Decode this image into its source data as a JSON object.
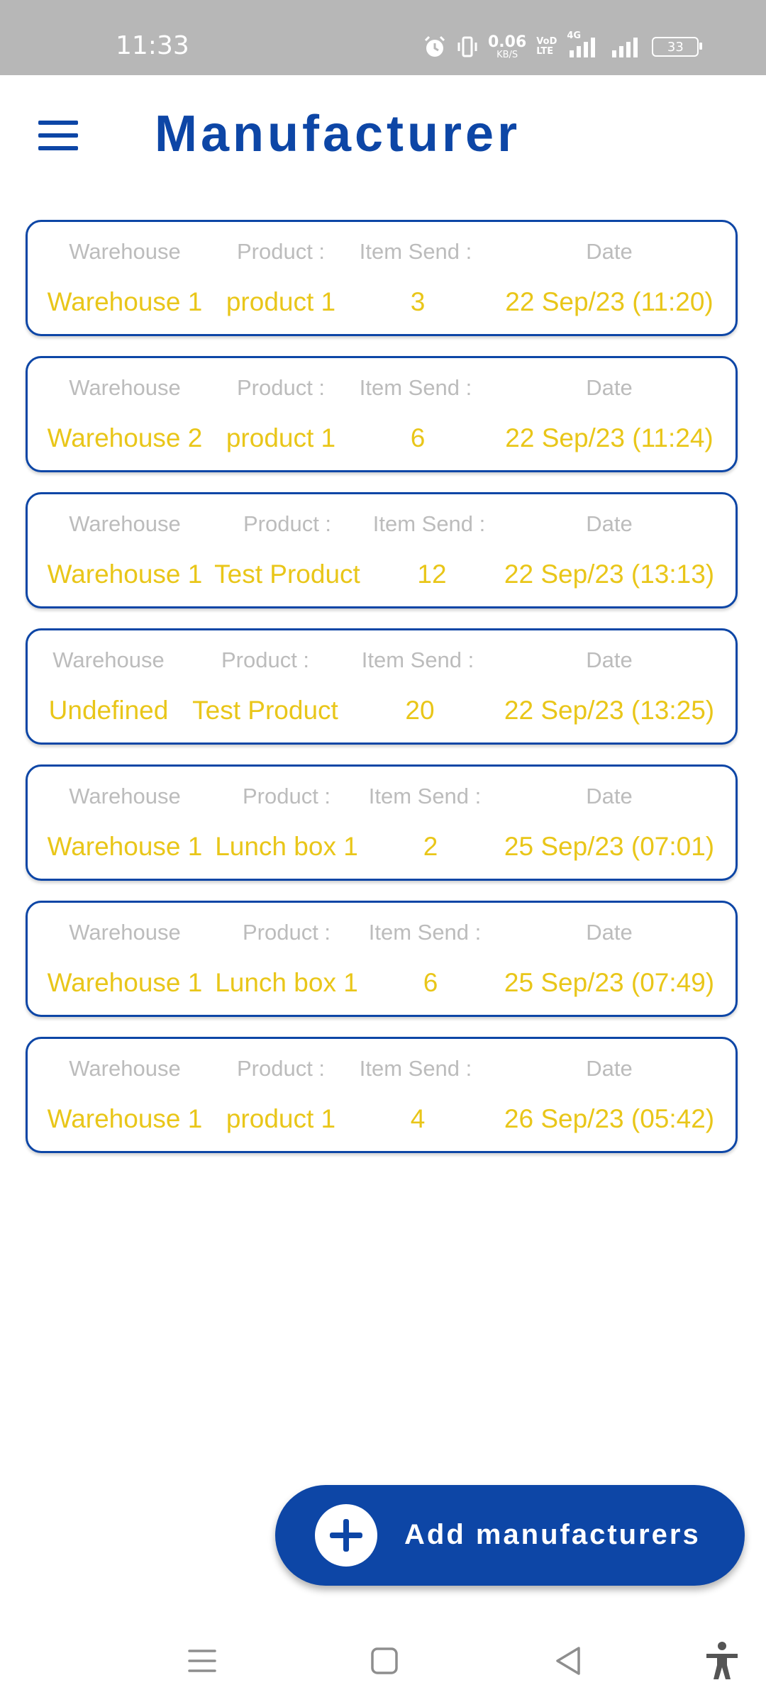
{
  "status_bar": {
    "time": "11:33",
    "speed_value": "0.06",
    "speed_unit": "KB/S",
    "volte_top": "VoD",
    "volte_bottom": "LTE",
    "network": "4G",
    "battery": "33",
    "icons": [
      "alarm-icon",
      "vibrate-icon",
      "signal-icon",
      "signal-icon-2",
      "battery-icon"
    ]
  },
  "header": {
    "title": "Manufacturer",
    "menu_icon": "hamburger-menu-icon"
  },
  "records": [
    {
      "warehouse_label": "Warehouse",
      "product_label": "Product :",
      "items_label": "Item Send :",
      "date_label": "Date",
      "warehouse": "Warehouse 1",
      "product": "product 1",
      "items": "3",
      "date": "22 Sep/23 (11:20)"
    },
    {
      "warehouse_label": "Warehouse",
      "product_label": "Product :",
      "items_label": "Item Send :",
      "date_label": "Date",
      "warehouse": "Warehouse 2",
      "product": "product 1",
      "items": "6",
      "date": "22 Sep/23 (11:24)"
    },
    {
      "warehouse_label": "Warehouse",
      "product_label": "Product :",
      "items_label": "Item Send :",
      "date_label": "Date",
      "warehouse": "Warehouse 1",
      "product": "Test Product",
      "items": "12",
      "date": "22 Sep/23 (13:13)"
    },
    {
      "warehouse_label": "Warehouse",
      "product_label": "Product :",
      "items_label": "Item Send :",
      "date_label": "Date",
      "warehouse": "Undefined",
      "product": "Test Product",
      "items": "20",
      "date": "22 Sep/23 (13:25)"
    },
    {
      "warehouse_label": "Warehouse",
      "product_label": "Product :",
      "items_label": "Item Send :",
      "date_label": "Date",
      "warehouse": "Warehouse 1",
      "product": "Lunch box 1",
      "items": "2",
      "date": "25 Sep/23 (07:01)"
    },
    {
      "warehouse_label": "Warehouse",
      "product_label": "Product :",
      "items_label": "Item Send :",
      "date_label": "Date",
      "warehouse": "Warehouse 1",
      "product": "Lunch box 1",
      "items": "6",
      "date": "25 Sep/23 (07:49)"
    },
    {
      "warehouse_label": "Warehouse",
      "product_label": "Product :",
      "items_label": "Item Send :",
      "date_label": "Date",
      "warehouse": "Warehouse 1",
      "product": "product 1",
      "items": "4",
      "date": "26 Sep/23 (05:42)"
    }
  ],
  "fab": {
    "label": "Add manufacturers",
    "icon": "plus-circle-icon"
  },
  "nav_bar": {
    "icons": [
      "recents-icon",
      "home-icon",
      "back-icon",
      "accessibility-icon"
    ]
  },
  "colors": {
    "primary": "#0d46a6",
    "value_text": "#e9c619",
    "label_text": "#bcbcbc",
    "status_bar": "#b7b7b7"
  }
}
